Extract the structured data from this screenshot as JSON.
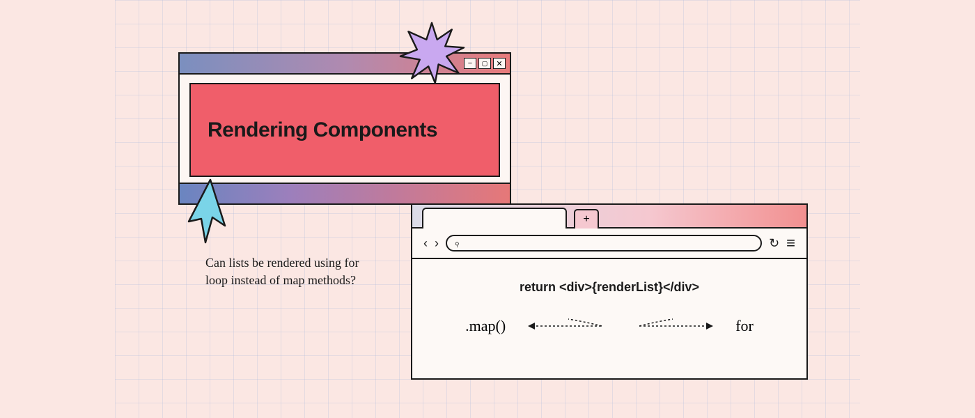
{
  "window1": {
    "title": "Rendering Components",
    "buttons": {
      "min": "−",
      "max": "▢",
      "close": "✕"
    }
  },
  "window2": {
    "newTab": "+",
    "nav": {
      "back": "‹",
      "forward": "›"
    },
    "icons": {
      "search": "⌕",
      "reload": "↻",
      "menu": "≡"
    },
    "code": "return <div>{renderList}</div>",
    "options": {
      "left": ".map()",
      "right": "for"
    }
  },
  "question": "Can lists be rendered using for loop instead of map methods?"
}
